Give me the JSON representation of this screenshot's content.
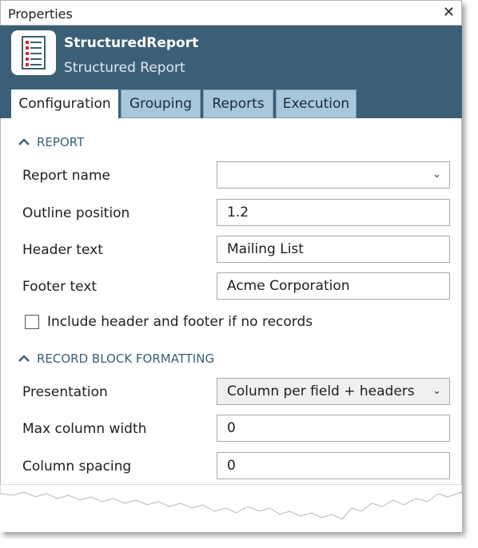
{
  "window": {
    "title": "Properties",
    "close_symbol": "✕"
  },
  "object": {
    "name": "StructuredReport",
    "type": "Structured Report",
    "icon": "report-list-icon"
  },
  "tabs": [
    {
      "label": "Configuration",
      "active": true
    },
    {
      "label": "Grouping",
      "active": false
    },
    {
      "label": "Reports",
      "active": false
    },
    {
      "label": "Execution",
      "active": false
    }
  ],
  "sections": {
    "report": {
      "title": "REPORT",
      "fields": {
        "report_name": {
          "label": "Report name",
          "value": ""
        },
        "outline_position": {
          "label": "Outline position",
          "value": "1.2"
        },
        "header_text": {
          "label": "Header text",
          "value": "Mailing List"
        },
        "footer_text": {
          "label": "Footer text",
          "value": "Acme Corporation"
        }
      },
      "include_checkbox": {
        "label": "Include header and footer if no records",
        "checked": false
      }
    },
    "record_block": {
      "title": "RECORD BLOCK FORMATTING",
      "fields": {
        "presentation": {
          "label": "Presentation",
          "value": "Column per field + headers"
        },
        "max_column_width": {
          "label": "Max column width",
          "value": "0"
        },
        "column_spacing": {
          "label": "Column spacing",
          "value": "0"
        }
      }
    }
  },
  "colors": {
    "header_bg": "#3b5f76",
    "tab_bg": "#a9c7da",
    "section_text": "#3b5f76"
  }
}
